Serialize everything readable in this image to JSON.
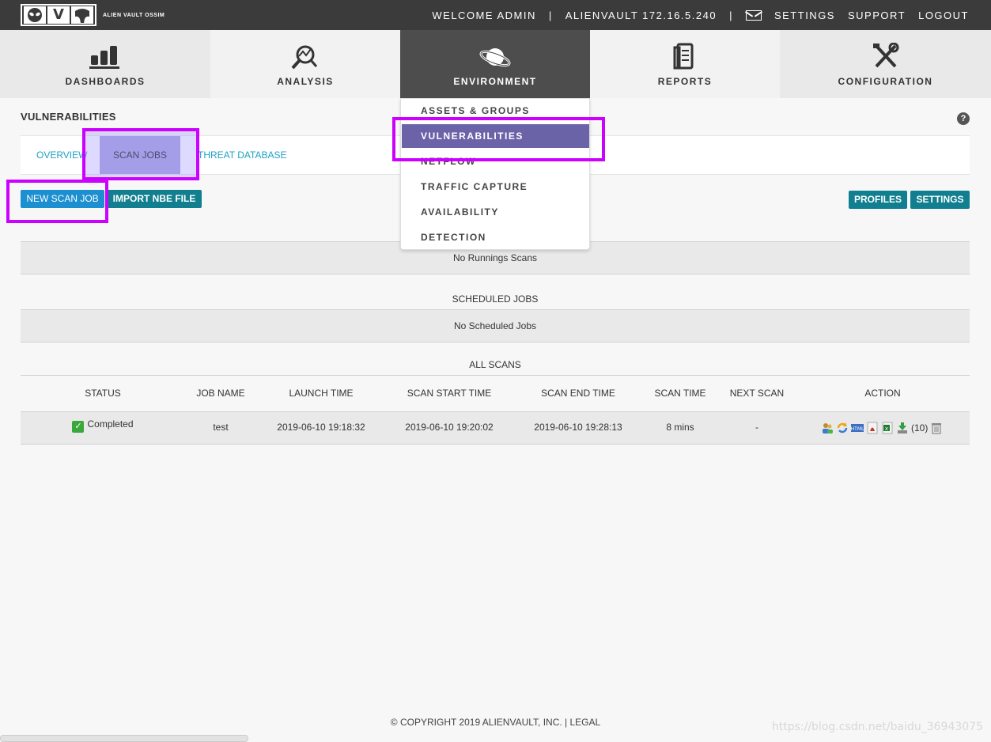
{
  "header": {
    "logo_letters": [
      "",
      "V",
      ""
    ],
    "logo_text": "ALIEN VAULT OSSIM",
    "welcome": "WELCOME ADMIN",
    "separator": "|",
    "server": "ALIENVAULT 172.16.5.240",
    "links": [
      "SETTINGS",
      "SUPPORT",
      "LOGOUT"
    ]
  },
  "mainnav": {
    "items": [
      {
        "label": "DASHBOARDS",
        "icon": "bar-chart-icon"
      },
      {
        "label": "ANALYSIS",
        "icon": "magnifier-icon"
      },
      {
        "label": "ENVIRONMENT",
        "icon": "planet-icon"
      },
      {
        "label": "REPORTS",
        "icon": "document-icon"
      },
      {
        "label": "CONFIGURATION",
        "icon": "tools-icon"
      }
    ],
    "active": "ENVIRONMENT"
  },
  "dropdown": {
    "items": [
      "ASSETS & GROUPS",
      "VULNERABILITIES",
      "NETFLOW",
      "TRAFFIC CAPTURE",
      "AVAILABILITY",
      "DETECTION"
    ],
    "active": "VULNERABILITIES"
  },
  "page": {
    "title": "VULNERABILITIES",
    "help": "?"
  },
  "tabs": {
    "items": [
      "OVERVIEW",
      "SCAN JOBS",
      "THREAT DATABASE"
    ],
    "active": "SCAN JOBS"
  },
  "toolbar": {
    "new_scan": "NEW SCAN JOB",
    "import_nbe": "IMPORT NBE FILE",
    "profiles": "PROFILES",
    "settings": "SETTINGS"
  },
  "running": {
    "empty": "No Runnings Scans"
  },
  "scheduled": {
    "heading": "SCHEDULED JOBS",
    "empty": "No Scheduled Jobs"
  },
  "all_scans": {
    "heading": "ALL SCANS",
    "columns": [
      "STATUS",
      "JOB NAME",
      "LAUNCH TIME",
      "SCAN START TIME",
      "SCAN END TIME",
      "SCAN TIME",
      "NEXT SCAN",
      "ACTION"
    ],
    "rows": [
      {
        "status": "Completed",
        "job_name": "test",
        "launch_time": "2019-06-10 19:18:32",
        "start_time": "2019-06-10 19:20:02",
        "end_time": "2019-06-10 19:28:13",
        "scan_time": "8 mins",
        "next_scan": "-",
        "count": "(10)"
      }
    ]
  },
  "footer": {
    "copyright": "© COPYRIGHT 2019 ALIENVAULT, INC. | LEGAL",
    "watermark": "https://blog.csdn.net/baidu_36943075"
  },
  "colors": {
    "topbar": "#3b3b3b",
    "active_nav": "#4d4d4d",
    "active_dropdown": "#6a63a8",
    "teal_button": "#117f8f",
    "blue_button": "#1b8fd0",
    "tab_link": "#1ea2c5",
    "highlight": "#cc00ff"
  }
}
